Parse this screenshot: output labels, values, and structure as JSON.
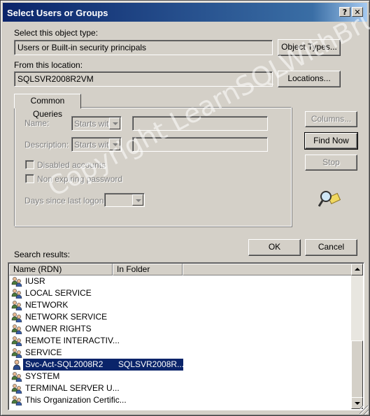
{
  "window": {
    "title": "Select Users or Groups",
    "help_label": "?",
    "close_label": "✕"
  },
  "object_type": {
    "label": "Select this object type:",
    "value": "Users or Built-in security principals",
    "button": "Object Types..."
  },
  "location": {
    "label": "From this location:",
    "value": "SQLSVR2008R2VM",
    "button": "Locations..."
  },
  "queries": {
    "tab": "Common Queries",
    "name_label": "Name:",
    "name_mode": "Starts with",
    "description_label": "Description:",
    "description_mode": "Starts with",
    "disabled_accounts": "Disabled accounts",
    "non_expiring": "Non expiring password",
    "days_label": "Days since last logon:"
  },
  "side_buttons": {
    "columns": "Columns...",
    "find_now": "Find Now",
    "stop": "Stop"
  },
  "footer": {
    "ok": "OK",
    "cancel": "Cancel",
    "results_label": "Search results:"
  },
  "results": {
    "columns": [
      "Name (RDN)",
      "In Folder"
    ],
    "rows": [
      {
        "name": "IUSR",
        "folder": "",
        "icon": "group-icon"
      },
      {
        "name": "LOCAL SERVICE",
        "folder": "",
        "icon": "group-icon"
      },
      {
        "name": "NETWORK",
        "folder": "",
        "icon": "group-icon"
      },
      {
        "name": "NETWORK SERVICE",
        "folder": "",
        "icon": "group-icon"
      },
      {
        "name": "OWNER RIGHTS",
        "folder": "",
        "icon": "group-icon"
      },
      {
        "name": "REMOTE INTERACTIV...",
        "folder": "",
        "icon": "group-icon"
      },
      {
        "name": "SERVICE",
        "folder": "",
        "icon": "group-icon"
      },
      {
        "name": "Svc-Act-SQL2008R2",
        "folder": "SQLSVR2008R...",
        "icon": "user-icon",
        "selected": true
      },
      {
        "name": "SYSTEM",
        "folder": "",
        "icon": "group-icon"
      },
      {
        "name": "TERMINAL SERVER U...",
        "folder": "",
        "icon": "group-icon"
      },
      {
        "name": "This Organization Certific...",
        "folder": "",
        "icon": "group-icon"
      }
    ]
  },
  "watermark": "Copyright LearnSQLWithBru",
  "colors": {
    "title_start": "#0a246a",
    "title_end": "#a6caf0",
    "selection": "#0a246a",
    "face": "#d4d0c8"
  }
}
